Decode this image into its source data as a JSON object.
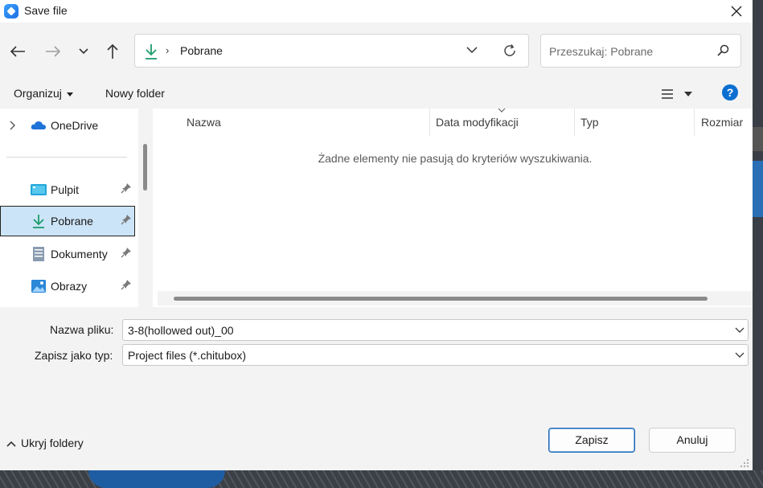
{
  "window": {
    "title": "Save file"
  },
  "address_bar": {
    "location": "Pobrane"
  },
  "search": {
    "placeholder": "Przeszukaj: Pobrane"
  },
  "command_bar": {
    "organize_label": "Organizuj",
    "new_folder_label": "Nowy folder",
    "help_label": "?"
  },
  "nav_pane": {
    "items": [
      {
        "label": "OneDrive",
        "icon": "onedrive-cloud-icon",
        "pinned": false
      },
      {
        "label": "Pulpit",
        "icon": "desktop-icon",
        "pinned": true
      },
      {
        "label": "Pobrane",
        "icon": "download-icon",
        "pinned": true,
        "selected": true
      },
      {
        "label": "Dokumenty",
        "icon": "document-icon",
        "pinned": true
      },
      {
        "label": "Obrazy",
        "icon": "pictures-icon",
        "pinned": true
      }
    ]
  },
  "file_list": {
    "columns": [
      "Nazwa",
      "Data modyfikacji",
      "Typ",
      "Rozmiar"
    ],
    "empty_message": "Żadne elementy nie pasują do kryteriów wyszukiwania."
  },
  "form": {
    "filename_label": "Nazwa pliku:",
    "filename_value": "3-8(hollowed out)_00",
    "filetype_label": "Zapisz jako typ:",
    "filetype_value": "Project files (*.chitubox)"
  },
  "footer": {
    "hide_folders_label": "Ukryj foldery",
    "save_label": "Zapisz",
    "cancel_label": "Anuluj"
  },
  "colors": {
    "accent": "#0a6fd0",
    "selection": "#cce4f7",
    "download_green": "#1f9d6b",
    "onedrive_blue": "#1e73d8"
  }
}
